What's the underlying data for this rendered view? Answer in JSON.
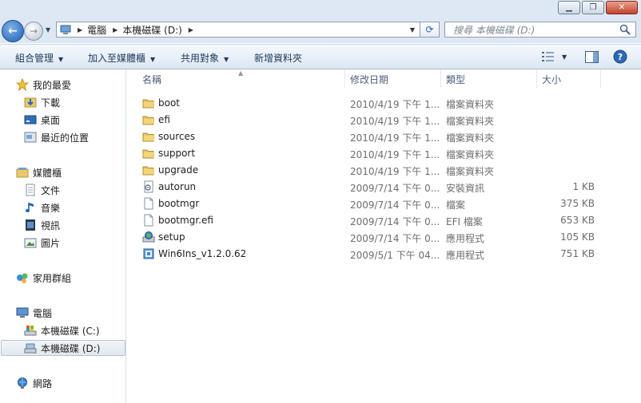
{
  "window": {
    "minimize_glyph": "▁",
    "maximize_glyph": "❐",
    "close_glyph": "✕"
  },
  "nav": {
    "back_glyph": "←",
    "forward_glyph": "→",
    "history_glyph": "▼"
  },
  "address": {
    "sep": "▶",
    "crumbs": [
      "電腦",
      "本機磁碟 (D:)"
    ],
    "dropdown_glyph": "▼",
    "refresh_glyph": "⟳"
  },
  "search": {
    "placeholder": "搜尋 本機磁碟 (D:)"
  },
  "toolbar": {
    "organize": "組合管理",
    "include_library": "加入至媒體櫃",
    "share_with": "共用對象",
    "new_folder": "新增資料夾",
    "caret": "▼",
    "help_glyph": "?"
  },
  "sidebar": {
    "favorites": "我的最愛",
    "downloads": "下載",
    "desktop": "桌面",
    "recent_places": "最近的位置",
    "libraries": "媒體櫃",
    "documents": "文件",
    "music": "音樂",
    "videos": "視訊",
    "pictures": "圖片",
    "homegroup": "家用群組",
    "computer": "電腦",
    "drive_c": "本機磁碟 (C:)",
    "drive_d": "本機磁碟 (D:)",
    "network": "網路"
  },
  "columns": {
    "name": "名稱",
    "date_modified": "修改日期",
    "type": "類型",
    "size": "大小",
    "sort_glyph": "▲"
  },
  "files": [
    {
      "name": "boot",
      "date": "2010/4/19 下午 1...",
      "type": "檔案資料夾",
      "size": "",
      "icon": "folder-icon"
    },
    {
      "name": "efi",
      "date": "2010/4/19 下午 1...",
      "type": "檔案資料夾",
      "size": "",
      "icon": "folder-icon"
    },
    {
      "name": "sources",
      "date": "2010/4/19 下午 1...",
      "type": "檔案資料夾",
      "size": "",
      "icon": "folder-icon"
    },
    {
      "name": "support",
      "date": "2010/4/19 下午 1...",
      "type": "檔案資料夾",
      "size": "",
      "icon": "folder-icon"
    },
    {
      "name": "upgrade",
      "date": "2010/4/19 下午 1...",
      "type": "檔案資料夾",
      "size": "",
      "icon": "folder-icon"
    },
    {
      "name": "autorun",
      "date": "2009/7/14 下午 0...",
      "type": "安裝資訊",
      "size": "1 KB",
      "icon": "setup-info-icon"
    },
    {
      "name": "bootmgr",
      "date": "2009/7/14 下午 0...",
      "type": "檔案",
      "size": "375 KB",
      "icon": "file-icon"
    },
    {
      "name": "bootmgr.efi",
      "date": "2009/7/14 下午 0...",
      "type": "EFI 檔案",
      "size": "653 KB",
      "icon": "file-icon"
    },
    {
      "name": "setup",
      "date": "2009/7/14 下午 0...",
      "type": "應用程式",
      "size": "105 KB",
      "icon": "setup-app-icon"
    },
    {
      "name": "Win6Ins_v1.2.0.62",
      "date": "2009/5/1 下午 04...",
      "type": "應用程式",
      "size": "751 KB",
      "icon": "installer-app-icon"
    }
  ]
}
